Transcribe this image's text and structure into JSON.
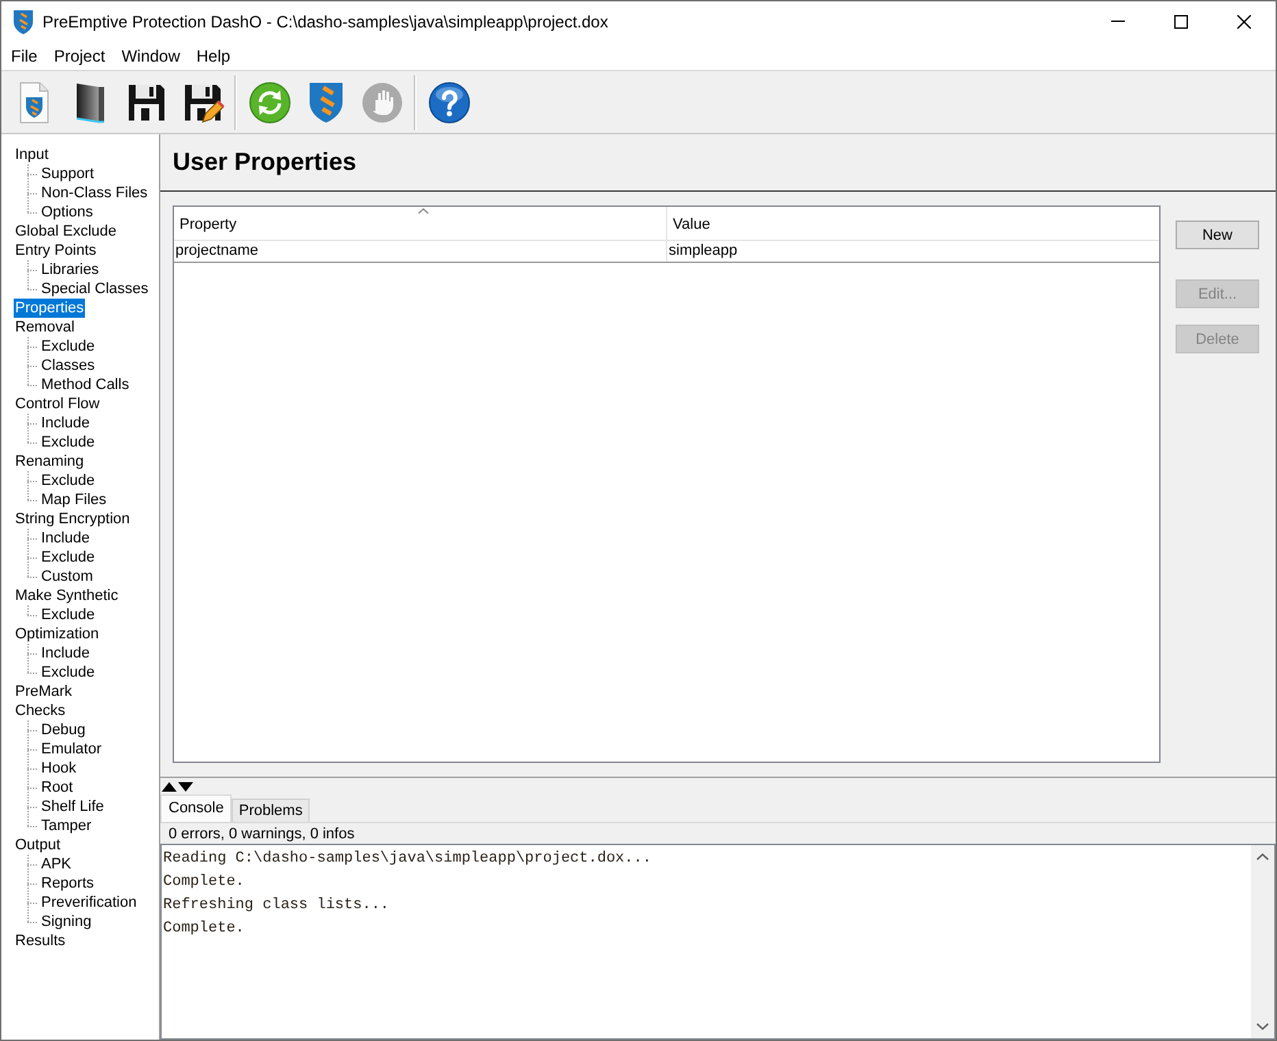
{
  "window": {
    "title": "PreEmptive Protection DashO - C:\\dasho-samples\\java\\simpleapp\\project.dox"
  },
  "menu": {
    "items": [
      "File",
      "Project",
      "Window",
      "Help"
    ]
  },
  "toolbar": {
    "groups": [
      {
        "buttons": [
          {
            "disabled": false
          },
          {
            "disabled": false
          },
          {
            "disabled": false
          },
          {
            "disabled": false
          }
        ]
      },
      {
        "buttons": [
          {
            "disabled": false
          },
          {
            "disabled": false
          },
          {
            "disabled": true
          }
        ]
      },
      {
        "buttons": [
          {
            "disabled": false
          }
        ]
      }
    ]
  },
  "sidebar": {
    "items": [
      {
        "label": "Input",
        "selected": false,
        "children": [
          {
            "label": "Support",
            "selected": false
          },
          {
            "label": "Non-Class Files",
            "selected": false
          },
          {
            "label": "Options",
            "selected": false
          }
        ]
      },
      {
        "label": "Global Exclude",
        "selected": false
      },
      {
        "label": "Entry Points",
        "selected": false,
        "children": [
          {
            "label": "Libraries",
            "selected": false
          },
          {
            "label": "Special Classes",
            "selected": false
          }
        ]
      },
      {
        "label": "Properties",
        "selected": true
      },
      {
        "label": "Removal",
        "selected": false,
        "children": [
          {
            "label": "Exclude",
            "selected": false
          },
          {
            "label": "Classes",
            "selected": false
          },
          {
            "label": "Method Calls",
            "selected": false
          }
        ]
      },
      {
        "label": "Control Flow",
        "selected": false,
        "children": [
          {
            "label": "Include",
            "selected": false
          },
          {
            "label": "Exclude",
            "selected": false
          }
        ]
      },
      {
        "label": "Renaming",
        "selected": false,
        "children": [
          {
            "label": "Exclude",
            "selected": false
          },
          {
            "label": "Map Files",
            "selected": false
          }
        ]
      },
      {
        "label": "String Encryption",
        "selected": false,
        "children": [
          {
            "label": "Include",
            "selected": false
          },
          {
            "label": "Exclude",
            "selected": false
          },
          {
            "label": "Custom",
            "selected": false
          }
        ]
      },
      {
        "label": "Make Synthetic",
        "selected": false,
        "children": [
          {
            "label": "Exclude",
            "selected": false
          }
        ]
      },
      {
        "label": "Optimization",
        "selected": false,
        "children": [
          {
            "label": "Include",
            "selected": false
          },
          {
            "label": "Exclude",
            "selected": false
          }
        ]
      },
      {
        "label": "PreMark",
        "selected": false
      },
      {
        "label": "Checks",
        "selected": false,
        "children": [
          {
            "label": "Debug",
            "selected": false
          },
          {
            "label": "Emulator",
            "selected": false
          },
          {
            "label": "Hook",
            "selected": false
          },
          {
            "label": "Root",
            "selected": false
          },
          {
            "label": "Shelf Life",
            "selected": false
          },
          {
            "label": "Tamper",
            "selected": false
          }
        ]
      },
      {
        "label": "Output",
        "selected": false,
        "children": [
          {
            "label": "APK",
            "selected": false
          },
          {
            "label": "Reports",
            "selected": false
          },
          {
            "label": "Preverification",
            "selected": false
          },
          {
            "label": "Signing",
            "selected": false
          }
        ]
      },
      {
        "label": "Results",
        "selected": false
      }
    ]
  },
  "page": {
    "title": "User Properties"
  },
  "table": {
    "columns": [
      {
        "label": "Property",
        "sorted": true
      },
      {
        "label": "Value",
        "sorted": false
      }
    ],
    "rows": [
      {
        "cells": [
          "projectname",
          "simpleapp"
        ]
      }
    ]
  },
  "buttons": [
    {
      "label": "New",
      "disabled": false
    },
    {
      "label": "Edit...",
      "disabled": true
    },
    {
      "label": "Delete",
      "disabled": true
    }
  ],
  "console": {
    "tabs": [
      {
        "label": "Console",
        "selected": true
      },
      {
        "label": "Problems",
        "selected": false
      }
    ],
    "summary": "0 errors, 0 warnings, 0 infos",
    "lines": [
      "Reading C:\\dasho-samples\\java\\simpleapp\\project.dox...",
      "Complete.",
      "Refreshing class lists...",
      "Complete."
    ]
  }
}
